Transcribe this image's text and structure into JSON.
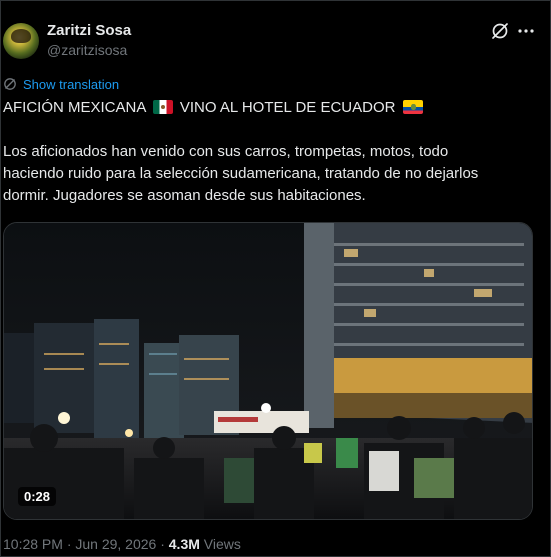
{
  "author": {
    "display_name": "Zaritzi Sosa",
    "handle": "@zaritzisosa"
  },
  "actions": {
    "grok_icon": "grok-icon",
    "more_icon": "more-horizontal-icon"
  },
  "translation": {
    "label": "Show translation"
  },
  "tweet": {
    "headline": "AFICIÓN MEXICANA",
    "headline_part2": "VINO AL HOTEL DE ECUADOR",
    "flags": [
      "mexico-flag",
      "ecuador-flag"
    ],
    "body_lines": [
      "Los aficionados han venido con sus carros, trompetas, motos, todo",
      "haciendo ruido para la selección sudamericana, tratando de no dejarlos",
      "dormir. Jugadores se asoman desde sus habitaciones."
    ]
  },
  "media": {
    "type": "video",
    "duration": "0:28"
  },
  "meta": {
    "timestamp": "10:28 PM · Jun 29, 2026 · ",
    "views_count": "4.3M",
    "views_label": " Views"
  },
  "colors": {
    "background": "#000000",
    "text": "#e7e9ea",
    "secondary": "#71767b",
    "link": "#1d9bf0"
  }
}
